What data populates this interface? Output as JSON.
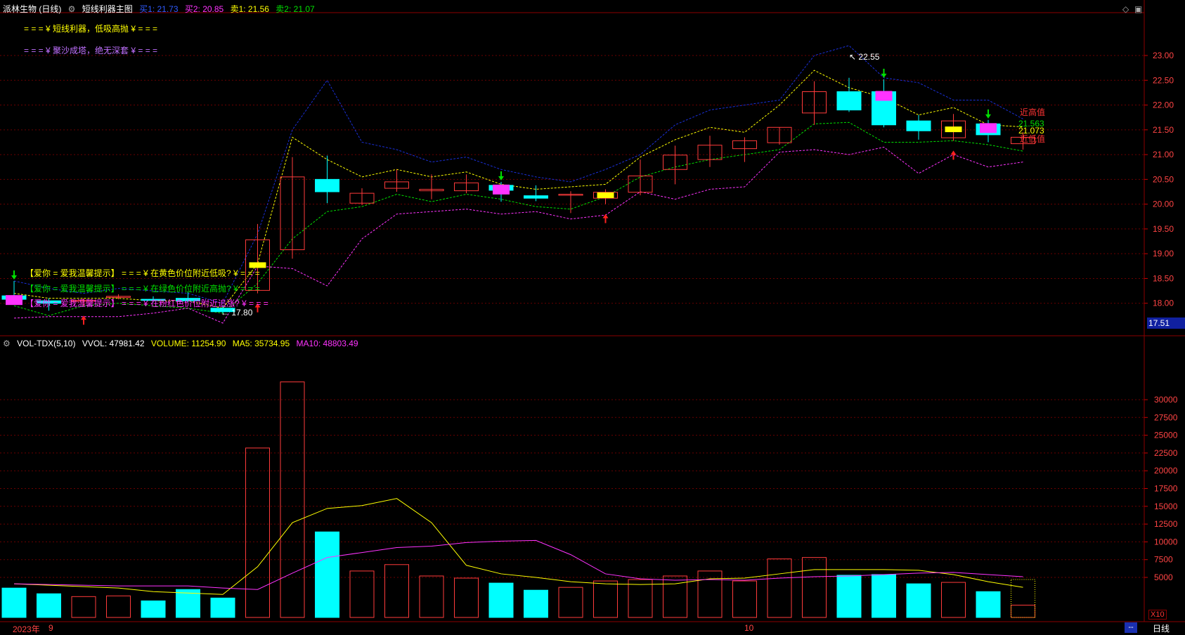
{
  "header": {
    "stock": "派林生物 (日线)",
    "indicator": "短线利器主图",
    "buy1": "买1: 21.73",
    "buy2": "买2: 20.85",
    "sell1": "卖1: 21.56",
    "sell2": "卖2: 21.07"
  },
  "vol_header": {
    "name": "VOL-TDX(5,10)",
    "vvol": "VVOL: 47981.42",
    "volume": "VOLUME: 11254.90",
    "ma5": "MA5: 35734.95",
    "ma10": "MA10: 48803.49"
  },
  "notes": {
    "line1": "= = = ¥ 短线利器，低吸高抛 ¥ = = =",
    "line2": "= = = ¥ 聚沙成塔，绝无深套 ¥ = = =",
    "tip_yellow": "【爱你 = 爱我温馨提示】 = = = ¥ 在黄色价位附近低吸? ¥ = = =",
    "tip_green": "【爱你 = 爱我温馨提示】 = = = ¥ 在绿色价位附近高抛? ¥ = = =",
    "tip_magenta": "【爱你 = 爱我温馨提示】 = = = ¥ 在粉红色价位附近追涨? ¥ = = ="
  },
  "labels": {
    "high_mark": "22.55",
    "low_mark": "17.80",
    "near_high": "近高值",
    "near_low": "近低值",
    "val_green": "21.563",
    "val_yellow": "21.073",
    "price_tag": "17.51",
    "x10": "X10",
    "period": "日线",
    "nav": "--"
  },
  "x_axis": {
    "year": "2023年",
    "m9": "9",
    "m10": "10"
  },
  "colors": {
    "up": "#ff3b3b",
    "down": "#00ffff",
    "grid": "#6b0000",
    "blue": "#1a2fd8",
    "yellow": "#ffff00",
    "green": "#00e000",
    "magenta": "#ff33ff"
  },
  "chart_data": {
    "type": "candlestick",
    "price_axis": {
      "min": 17.51,
      "max": 23.0,
      "ticks": [
        18.0,
        18.5,
        19.0,
        19.5,
        20.0,
        20.5,
        21.0,
        21.5,
        22.0,
        22.5,
        23.0
      ]
    },
    "volume_axis": {
      "ticks": [
        5000,
        7500,
        10000,
        12500,
        15000,
        17500,
        20000,
        22500,
        25000,
        27500,
        30000
      ]
    },
    "ohlc": [
      [
        18.15,
        18.45,
        18.02,
        18.08
      ],
      [
        18.05,
        18.1,
        17.85,
        18.0
      ],
      [
        18.05,
        18.1,
        17.95,
        18.06
      ],
      [
        18.12,
        18.18,
        18.08,
        18.14
      ],
      [
        18.08,
        18.14,
        18.02,
        18.06
      ],
      [
        18.1,
        18.22,
        18.02,
        18.05
      ],
      [
        17.9,
        17.95,
        17.8,
        17.83
      ],
      [
        18.26,
        19.6,
        18.2,
        19.28
      ],
      [
        19.08,
        20.95,
        18.9,
        20.55
      ],
      [
        20.5,
        20.98,
        20.02,
        20.25
      ],
      [
        20.02,
        20.32,
        19.98,
        20.22
      ],
      [
        20.32,
        20.7,
        20.25,
        20.45
      ],
      [
        20.27,
        20.6,
        20.1,
        20.3
      ],
      [
        20.27,
        20.6,
        20.22,
        20.43
      ],
      [
        20.38,
        20.45,
        20.05,
        20.28
      ],
      [
        20.17,
        20.38,
        20.06,
        20.12
      ],
      [
        20.2,
        20.26,
        19.82,
        20.2
      ],
      [
        20.12,
        20.3,
        20.0,
        20.24
      ],
      [
        20.24,
        20.9,
        20.18,
        20.57
      ],
      [
        20.7,
        21.18,
        20.4,
        20.99
      ],
      [
        20.9,
        21.38,
        20.75,
        21.19
      ],
      [
        21.12,
        21.35,
        20.85,
        21.28
      ],
      [
        21.24,
        21.55,
        21.2,
        21.55
      ],
      [
        21.84,
        22.48,
        21.6,
        22.27
      ],
      [
        22.27,
        22.55,
        21.86,
        21.9
      ],
      [
        22.27,
        22.52,
        21.55,
        21.6
      ],
      [
        21.68,
        21.8,
        21.3,
        21.48
      ],
      [
        21.34,
        21.82,
        21.28,
        21.68
      ],
      [
        21.62,
        21.7,
        21.25,
        21.4
      ],
      [
        21.22,
        21.45,
        21.1,
        21.35
      ]
    ],
    "volume": [
      3500,
      2700,
      2300,
      2400,
      1700,
      3300,
      2100,
      23200,
      32500,
      11400,
      5900,
      6800,
      5200,
      4900,
      4200,
      3200,
      3600,
      4500,
      4700,
      5200,
      5900,
      4500,
      7600,
      7800,
      5300,
      5400,
      4100,
      4300,
      3000,
      1100
    ],
    "vol_ma5": [
      4100,
      3900,
      3700,
      3500,
      3000,
      2800,
      2600,
      6500,
      12700,
      14700,
      15100,
      16100,
      12700,
      6700,
      5500,
      5000,
      4400,
      4100,
      4000,
      4100,
      4800,
      4900,
      5500,
      6100,
      6100,
      6100,
      6000,
      5400,
      4400,
      3600
    ],
    "vol_ma10": [
      4100,
      4000,
      3900,
      3800,
      3800,
      3800,
      3500,
      3300,
      5600,
      7800,
      8500,
      9200,
      9400,
      9900,
      10100,
      10200,
      8200,
      5500,
      4800,
      4600,
      4700,
      4600,
      4900,
      5100,
      5200,
      5400,
      5600,
      5700,
      5400,
      5100
    ],
    "line_blue": [
      18.45,
      18.3,
      18.2,
      18.3,
      18.25,
      18.2,
      18.0,
      19.4,
      21.5,
      22.5,
      21.25,
      21.1,
      20.85,
      20.95,
      20.7,
      20.55,
      20.45,
      20.7,
      21.0,
      21.6,
      21.9,
      22.0,
      22.1,
      23.0,
      23.2,
      22.55,
      22.45,
      22.1,
      22.1,
      21.72
    ],
    "line_yellow": [
      18.2,
      18.1,
      18.1,
      18.1,
      18.05,
      18.05,
      17.9,
      18.8,
      21.35,
      20.9,
      20.55,
      20.7,
      20.55,
      20.65,
      20.4,
      20.3,
      20.35,
      20.4,
      20.95,
      21.3,
      21.55,
      21.45,
      22.0,
      22.7,
      22.35,
      22.15,
      21.8,
      21.95,
      21.6,
      21.56
    ],
    "line_green": [
      17.95,
      17.75,
      17.95,
      18.0,
      17.95,
      17.9,
      17.8,
      18.4,
      19.3,
      19.85,
      19.95,
      20.2,
      20.05,
      20.2,
      20.1,
      19.95,
      19.9,
      20.15,
      20.55,
      20.75,
      20.9,
      21.0,
      21.1,
      21.62,
      21.65,
      21.25,
      21.25,
      21.28,
      21.2,
      21.07
    ],
    "line_magenta": [
      17.7,
      17.73,
      17.73,
      17.73,
      17.8,
      17.9,
      17.6,
      18.75,
      18.7,
      18.35,
      19.3,
      19.8,
      19.85,
      19.9,
      19.8,
      19.85,
      19.7,
      19.78,
      20.25,
      20.1,
      20.3,
      20.35,
      21.05,
      21.1,
      21.0,
      21.15,
      20.62,
      21.0,
      20.75,
      20.85
    ],
    "down_arrows": [
      0,
      14,
      25,
      28
    ],
    "up_arrows": [
      2,
      7,
      17,
      27
    ],
    "yellow_boxes": [
      7,
      17,
      27
    ],
    "magenta_boxes": [
      0,
      14,
      25,
      28
    ]
  }
}
